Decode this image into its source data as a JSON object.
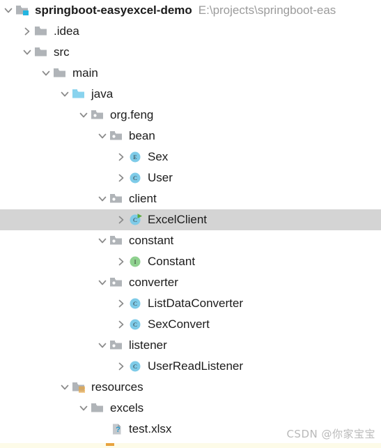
{
  "window": {
    "kind": "ide-project-tree",
    "background_color": "#ffffff",
    "selection_color": "#d4d4d4"
  },
  "project": {
    "root_label": "springboot-easyexcel-demo",
    "root_path": "E:\\projects\\springboot-eas"
  },
  "watermark": {
    "text": "CSDN @你家宝宝"
  },
  "colors": {
    "folder_gray": "#b0b4b8",
    "source_root_blue": "#89d3ee",
    "class_blue": "#7ecbe8",
    "interface_green": "#8fd18f",
    "run_arrow_green": "#5fb górze",
    "text": "#1b1b1b",
    "path_text": "#9b9b9b",
    "selection": "#d4d4d4"
  },
  "tree": {
    "rows": [
      {
        "label": "springboot-easyexcel-demo",
        "secondary": "E:\\projects\\springboot-eas",
        "depth": 0,
        "chevron": "expanded",
        "icon": "project-root-folder-icon",
        "bold": true,
        "selected": false
      },
      {
        "label": ".idea",
        "secondary": "",
        "depth": 1,
        "chevron": "collapsed",
        "icon": "folder-icon",
        "bold": false,
        "selected": false
      },
      {
        "label": "src",
        "secondary": "",
        "depth": 1,
        "chevron": "expanded",
        "icon": "folder-icon",
        "bold": false,
        "selected": false
      },
      {
        "label": "main",
        "secondary": "",
        "depth": 2,
        "chevron": "expanded",
        "icon": "folder-icon",
        "bold": false,
        "selected": false
      },
      {
        "label": "java",
        "secondary": "",
        "depth": 3,
        "chevron": "expanded",
        "icon": "source-root-folder-icon",
        "bold": false,
        "selected": false
      },
      {
        "label": "org.feng",
        "secondary": "",
        "depth": 4,
        "chevron": "expanded",
        "icon": "package-icon",
        "bold": false,
        "selected": false
      },
      {
        "label": "bean",
        "secondary": "",
        "depth": 5,
        "chevron": "expanded",
        "icon": "package-icon",
        "bold": false,
        "selected": false
      },
      {
        "label": "Sex",
        "secondary": "",
        "depth": 6,
        "chevron": "collapsed",
        "icon": "enum-icon",
        "bold": false,
        "selected": false
      },
      {
        "label": "User",
        "secondary": "",
        "depth": 6,
        "chevron": "collapsed",
        "icon": "class-icon",
        "bold": false,
        "selected": false
      },
      {
        "label": "client",
        "secondary": "",
        "depth": 5,
        "chevron": "expanded",
        "icon": "package-icon",
        "bold": false,
        "selected": false
      },
      {
        "label": "ExcelClient",
        "secondary": "",
        "depth": 6,
        "chevron": "collapsed",
        "icon": "runnable-class-icon",
        "bold": false,
        "selected": true
      },
      {
        "label": "constant",
        "secondary": "",
        "depth": 5,
        "chevron": "expanded",
        "icon": "package-icon",
        "bold": false,
        "selected": false
      },
      {
        "label": "Constant",
        "secondary": "",
        "depth": 6,
        "chevron": "collapsed",
        "icon": "interface-icon",
        "bold": false,
        "selected": false
      },
      {
        "label": "converter",
        "secondary": "",
        "depth": 5,
        "chevron": "expanded",
        "icon": "package-icon",
        "bold": false,
        "selected": false
      },
      {
        "label": "ListDataConverter",
        "secondary": "",
        "depth": 6,
        "chevron": "collapsed",
        "icon": "class-icon",
        "bold": false,
        "selected": false
      },
      {
        "label": "SexConvert",
        "secondary": "",
        "depth": 6,
        "chevron": "collapsed",
        "icon": "class-icon",
        "bold": false,
        "selected": false
      },
      {
        "label": "listener",
        "secondary": "",
        "depth": 5,
        "chevron": "expanded",
        "icon": "package-icon",
        "bold": false,
        "selected": false
      },
      {
        "label": "UserReadListener",
        "secondary": "",
        "depth": 6,
        "chevron": "collapsed",
        "icon": "class-icon",
        "bold": false,
        "selected": false
      },
      {
        "label": "resources",
        "secondary": "",
        "depth": 3,
        "chevron": "expanded",
        "icon": "resources-root-folder-icon",
        "bold": false,
        "selected": false
      },
      {
        "label": "excels",
        "secondary": "",
        "depth": 4,
        "chevron": "expanded",
        "icon": "folder-icon",
        "bold": false,
        "selected": false
      },
      {
        "label": "test.xlsx",
        "secondary": "",
        "depth": 5,
        "chevron": "none",
        "icon": "unknown-file-icon",
        "bold": false,
        "selected": false
      }
    ]
  }
}
